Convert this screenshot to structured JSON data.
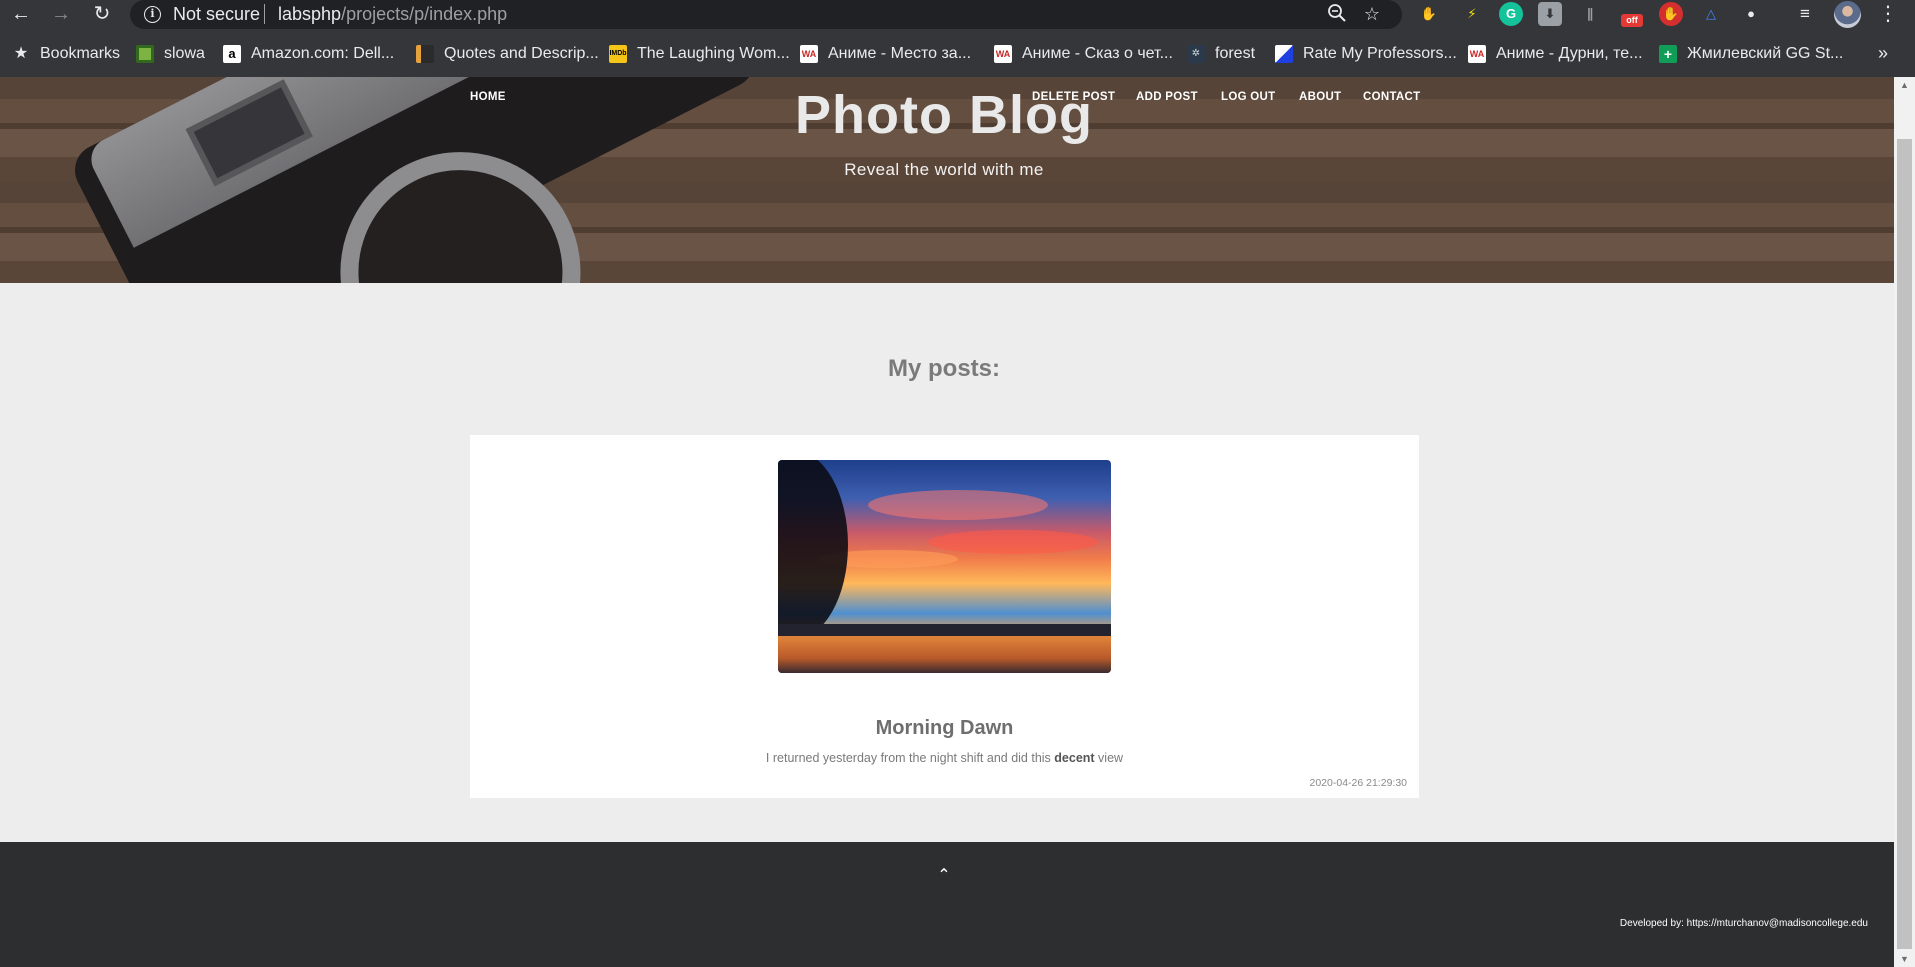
{
  "browser": {
    "nav": {
      "back": "←",
      "forward": "→",
      "reload": "↻"
    },
    "omnibox": {
      "info": "i",
      "security": "Not secure",
      "host": "labsphp",
      "path": "/projects/p/index.php",
      "zoom_icon": "zoom-icon",
      "star_icon": "star-icon"
    },
    "extensions": [
      {
        "name": "hand-icon",
        "glyph": "✋"
      },
      {
        "name": "bolt-icon",
        "glyph": "⚡"
      },
      {
        "name": "grammarly-icon",
        "glyph": "G"
      },
      {
        "name": "save-icon",
        "glyph": "⬇"
      },
      {
        "name": "signal-icon",
        "glyph": "∥"
      },
      {
        "name": "off-badge-icon",
        "glyph": "off"
      },
      {
        "name": "stop-hand-icon",
        "glyph": "✋"
      },
      {
        "name": "drive-icon",
        "glyph": "△"
      },
      {
        "name": "dots-icon",
        "glyph": "●"
      },
      {
        "name": "queue-icon",
        "glyph": "≡"
      }
    ],
    "menu": "⋮",
    "bookmarks_label": "Bookmarks",
    "bookmarks": [
      {
        "label": "slowa",
        "icon_color": "#7cb342",
        "glyph": ""
      },
      {
        "label": "Amazon.com: Dell...",
        "icon_color": "#ffffff",
        "glyph": "a"
      },
      {
        "label": "Quotes and Descrip...",
        "icon_color": "#e6a23c",
        "glyph": ""
      },
      {
        "label": "The Laughing Wom...",
        "icon_color": "#f5c518",
        "glyph": "IMDb"
      },
      {
        "label": "Аниме - Место за...",
        "icon_color": "#c62828",
        "glyph": "WA"
      },
      {
        "label": "Аниме - Сказ о чет...",
        "icon_color": "#c62828",
        "glyph": "WA"
      },
      {
        "label": "forest",
        "icon_color": "#2b3a4a",
        "glyph": "✲"
      },
      {
        "label": "Rate My Professors...",
        "icon_color": "#1e40e0",
        "glyph": ""
      },
      {
        "label": "Аниме - Дурни, те...",
        "icon_color": "#c62828",
        "glyph": "WA"
      },
      {
        "label": "Жмилевский GG St...",
        "icon_color": "#0f9d58",
        "glyph": "+"
      }
    ],
    "more": "»"
  },
  "site": {
    "nav": [
      "HOME",
      "DELETE POST",
      "ADD POST",
      "LOG OUT",
      "ABOUT",
      "CONTACT"
    ],
    "title": "Photo Blog",
    "subtitle": "Reveal the world with me",
    "section_title": "My posts:"
  },
  "post": {
    "title": "Morning Dawn",
    "body_before": "I returned yesterday from the night shift and did this ",
    "body_bold": "decent",
    "body_after": " view",
    "date": "2020-04-26 21:29:30",
    "image_alt": "sunset-photo"
  },
  "footer": {
    "back_to_top": "⌃",
    "credit": "Developed by: https://mturchanov@madisoncollege.edu"
  },
  "colors": {
    "chrome": "#35363a",
    "omnibox": "#202124",
    "page_bg": "#ededed",
    "footer_bg": "#2d2e30"
  }
}
